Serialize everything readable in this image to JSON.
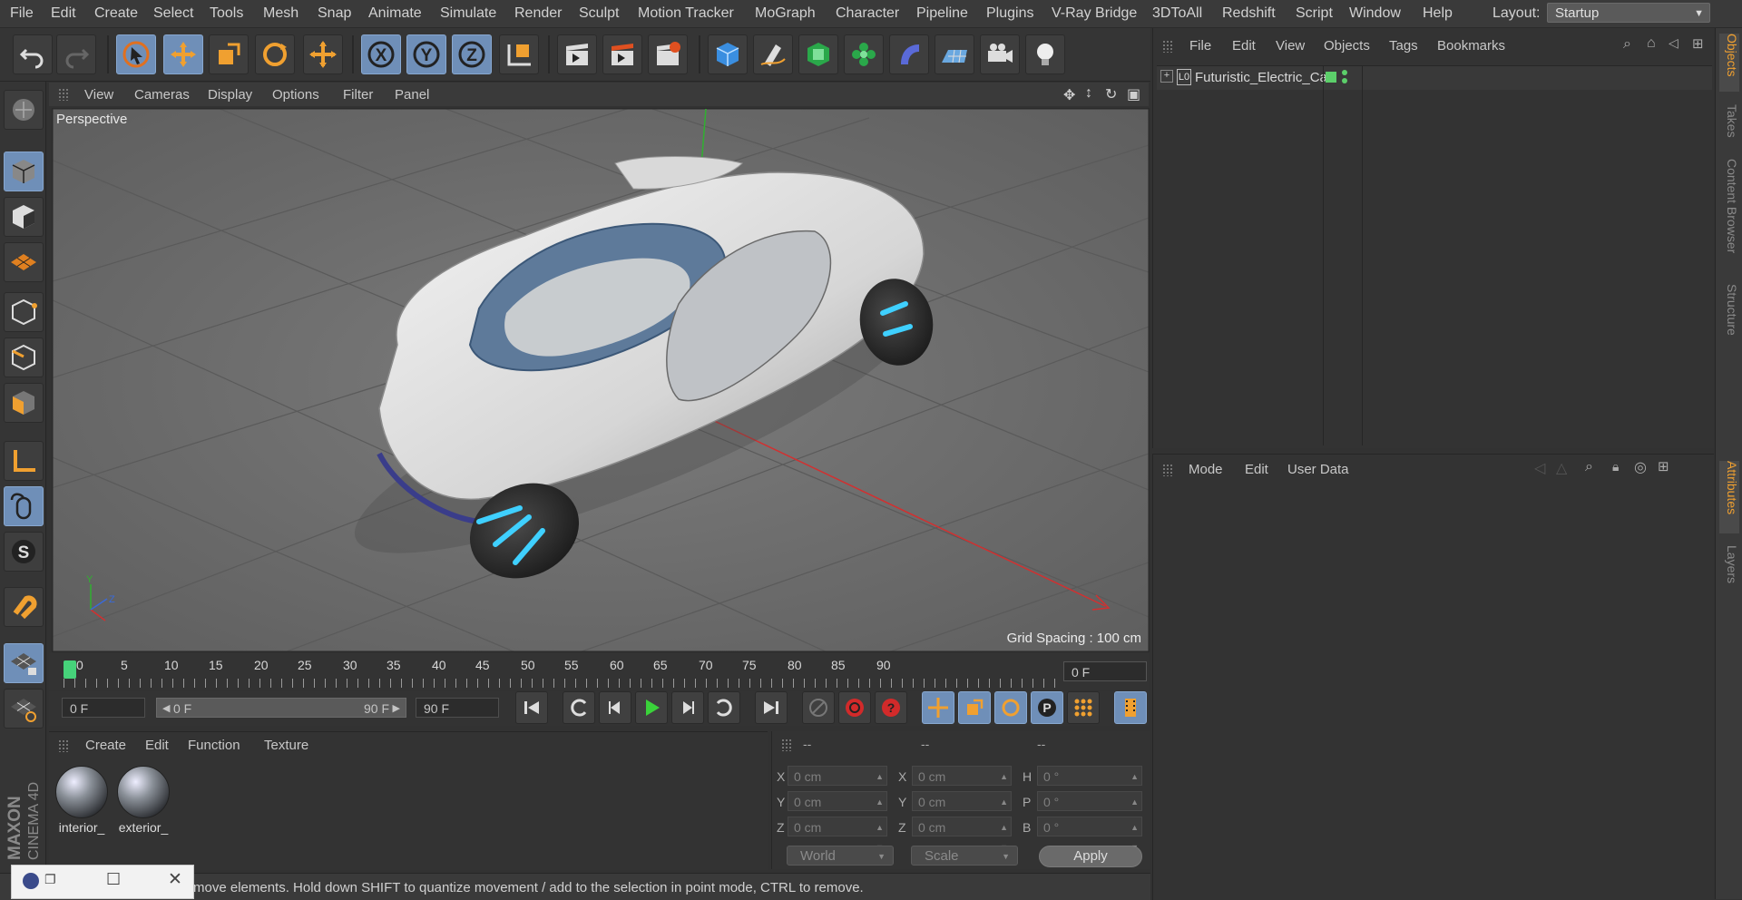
{
  "menubar": {
    "items": [
      "File",
      "Edit",
      "Create",
      "Select",
      "Tools",
      "Mesh",
      "Snap",
      "Animate",
      "Simulate",
      "Render",
      "Sculpt",
      "Motion Tracker",
      "MoGraph",
      "Character",
      "Pipeline",
      "Plugins",
      "V-Ray Bridge",
      "3DToAll",
      "Redshift",
      "Script",
      "Window",
      "Help"
    ],
    "layout_label": "Layout:",
    "layout_value": "Startup"
  },
  "viewport": {
    "menu": [
      "View",
      "Cameras",
      "Display",
      "Options",
      "Filter",
      "Panel"
    ],
    "label": "Perspective",
    "grid_spacing": "Grid Spacing : 100 cm"
  },
  "timeline": {
    "ticks": [
      "0",
      "5",
      "10",
      "15",
      "20",
      "25",
      "30",
      "35",
      "40",
      "45",
      "50",
      "55",
      "60",
      "65",
      "70",
      "75",
      "80",
      "85",
      "90"
    ],
    "current_frame": "0 F",
    "start_field": "0 F",
    "range_start": "0 F",
    "range_end": "90 F",
    "end_field": "90 F"
  },
  "materials": {
    "menu": [
      "Create",
      "Edit",
      "Function",
      "Texture"
    ],
    "items": [
      {
        "label": "interior_"
      },
      {
        "label": "exterior_"
      }
    ]
  },
  "coordinates": {
    "headers": [
      "--",
      "--",
      "--"
    ],
    "rows": [
      {
        "l1": "X",
        "v1": "0 cm",
        "l2": "X",
        "v2": "0 cm",
        "l3": "H",
        "v3": "0 °"
      },
      {
        "l1": "Y",
        "v1": "0 cm",
        "l2": "Y",
        "v2": "0 cm",
        "l3": "P",
        "v3": "0 °"
      },
      {
        "l1": "Z",
        "v1": "0 cm",
        "l2": "Z",
        "v2": "0 cm",
        "l3": "B",
        "v3": "0 °"
      }
    ],
    "space": "World",
    "mode": "Scale",
    "apply": "Apply"
  },
  "objects": {
    "menu": [
      "File",
      "Edit",
      "View",
      "Objects",
      "Tags",
      "Bookmarks"
    ],
    "items": [
      {
        "name": "Futuristic_Electric_Car",
        "icon": "null-object-icon"
      }
    ]
  },
  "attributes": {
    "menu": [
      "Mode",
      "Edit",
      "User Data"
    ]
  },
  "right_tabs": {
    "top": [
      "Objects",
      "Takes",
      "Content Browser",
      "Structure"
    ],
    "bottom": [
      "Attributes",
      "Layers"
    ]
  },
  "status": {
    "text": "move elements. Hold down SHIFT to quantize movement / add to the selection in point mode, CTRL to remove."
  },
  "branding": {
    "text": "MAXON CINEMA 4D"
  },
  "colors": {
    "accent_blue": "#6f8fb8",
    "accent_orange": "#f0a030",
    "axis_x": "#d23030",
    "axis_y": "#30b030",
    "playhead": "#46d27a"
  }
}
